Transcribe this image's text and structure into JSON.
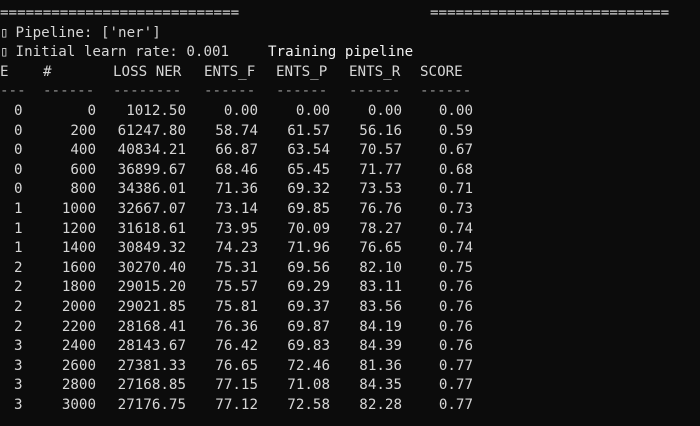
{
  "header": {
    "left_rule": "============================",
    "title": "Training pipeline",
    "right_rule": "============================"
  },
  "info": {
    "pipeline": "Pipeline: ['ner']",
    "learn_rate": "Initial learn rate: 0.001"
  },
  "table": {
    "columns": [
      "E",
      "#",
      "LOSS NER",
      "ENTS_F",
      "ENTS_P",
      "ENTS_R",
      "SCORE"
    ],
    "dashes": [
      "---",
      "------",
      "--------",
      "------",
      "------",
      "------",
      "------"
    ],
    "rows": [
      [
        "0",
        "0",
        "1012.50",
        "0.00",
        "0.00",
        "0.00",
        "0.00"
      ],
      [
        "0",
        "200",
        "61247.80",
        "58.74",
        "61.57",
        "56.16",
        "0.59"
      ],
      [
        "0",
        "400",
        "40834.21",
        "66.87",
        "63.54",
        "70.57",
        "0.67"
      ],
      [
        "0",
        "600",
        "36899.67",
        "68.46",
        "65.45",
        "71.77",
        "0.68"
      ],
      [
        "0",
        "800",
        "34386.01",
        "71.36",
        "69.32",
        "73.53",
        "0.71"
      ],
      [
        "1",
        "1000",
        "32667.07",
        "73.14",
        "69.85",
        "76.76",
        "0.73"
      ],
      [
        "1",
        "1200",
        "31618.61",
        "73.95",
        "70.09",
        "78.27",
        "0.74"
      ],
      [
        "1",
        "1400",
        "30849.32",
        "74.23",
        "71.96",
        "76.65",
        "0.74"
      ],
      [
        "2",
        "1600",
        "30270.40",
        "75.31",
        "69.56",
        "82.10",
        "0.75"
      ],
      [
        "2",
        "1800",
        "29015.20",
        "75.57",
        "69.29",
        "83.11",
        "0.76"
      ],
      [
        "2",
        "2000",
        "29021.85",
        "75.81",
        "69.37",
        "83.56",
        "0.76"
      ],
      [
        "2",
        "2200",
        "28168.41",
        "76.36",
        "69.87",
        "84.19",
        "0.76"
      ],
      [
        "3",
        "2400",
        "28143.67",
        "76.42",
        "69.83",
        "84.39",
        "0.76"
      ],
      [
        "3",
        "2600",
        "27381.33",
        "76.65",
        "72.46",
        "81.36",
        "0.77"
      ],
      [
        "3",
        "2800",
        "27168.85",
        "77.15",
        "71.08",
        "84.35",
        "0.77"
      ],
      [
        "3",
        "3000",
        "27176.75",
        "77.12",
        "72.58",
        "82.28",
        "0.77"
      ]
    ]
  }
}
